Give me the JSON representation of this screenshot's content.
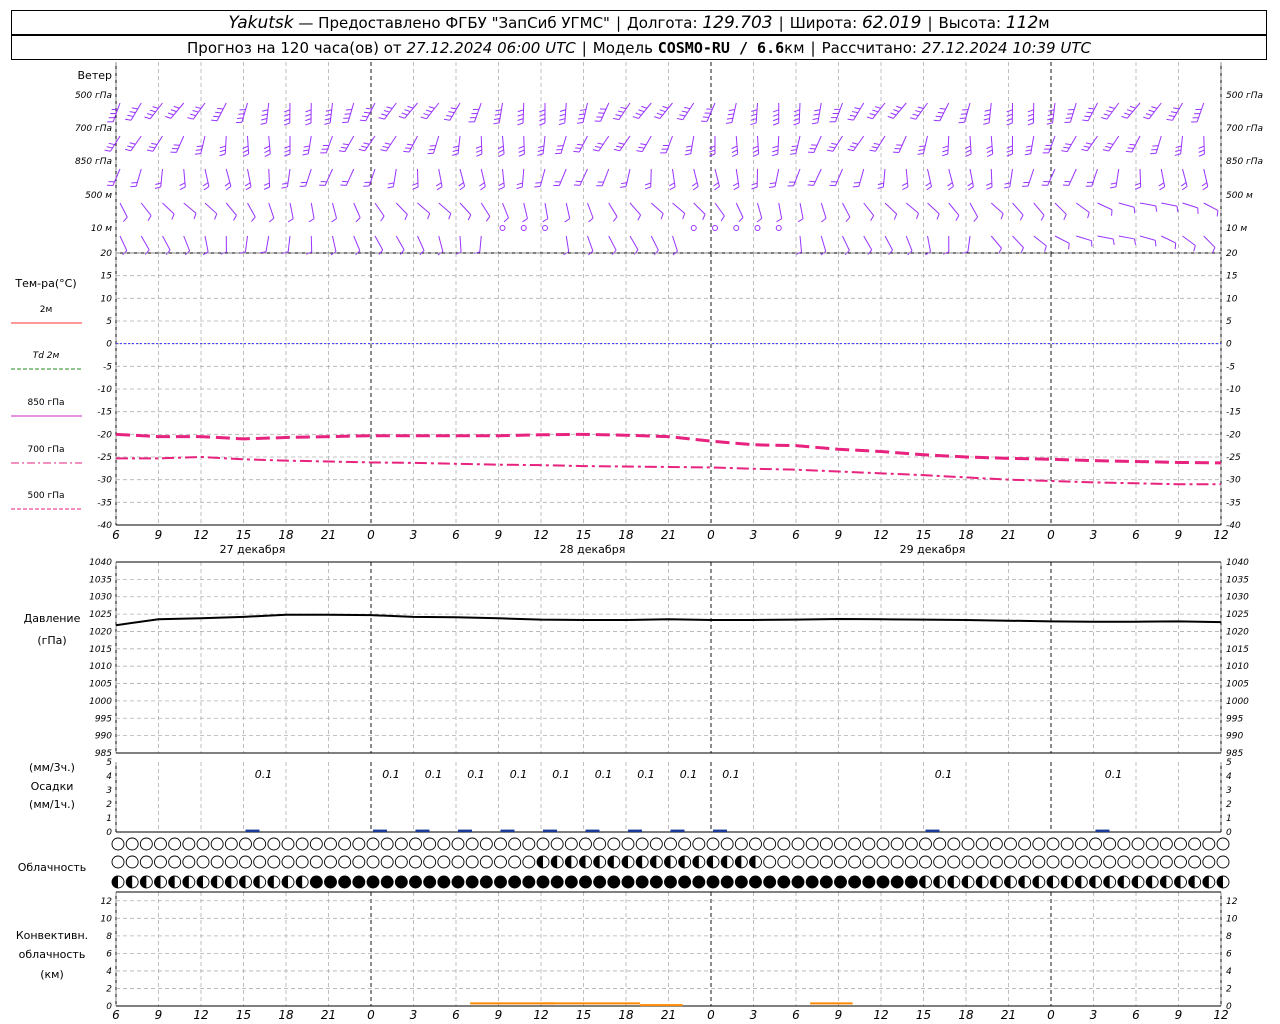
{
  "header": {
    "station": "Yakutsk",
    "provided": "— Предоставлено ФГБУ \"ЗапСиб УГМС\"",
    "lon_label": "Долгота:",
    "lon": "129.703",
    "lat_label": "Широта:",
    "lat": "62.019",
    "alt_label": "Высота:",
    "alt": "112",
    "alt_unit": "м",
    "forecast_prefix": "Прогноз на 120 часа(ов) от",
    "forecast_start": "27.12.2024 06:00 UTC",
    "model_label": "Модель",
    "model": "COSMO-RU / 6.6",
    "model_unit": "км",
    "calc_label": "Рассчитано:",
    "calc_time": "27.12.2024 10:39 UTC"
  },
  "colors": {
    "wind": "#9933ff",
    "t500": "#e8227f",
    "t700": "#e8227f",
    "t850": "#cc22cc",
    "t2m": "#ff3333",
    "td2m": "#228b22",
    "zero_line": "#3333ff",
    "pressure": "#000000",
    "precip": "#1a3a99",
    "conv": "#ff8800",
    "grid": "#b0b0b0"
  },
  "x_ticks": [
    "6",
    "9",
    "12",
    "15",
    "18",
    "21",
    "0",
    "3",
    "6",
    "9",
    "12",
    "15",
    "18",
    "21",
    "0",
    "3",
    "6",
    "9",
    "12",
    "15",
    "18",
    "21",
    "0",
    "3",
    "6",
    "9",
    "12"
  ],
  "dates": [
    "27 декабря",
    "28 декабря",
    "29 декабря"
  ],
  "wind_panel": {
    "title": "Ветер",
    "levels": [
      "500 гПа",
      "700 гПа",
      "850 гПа",
      "500 м",
      "10  м"
    ]
  },
  "temp_panel": {
    "title": "Тем-ра(°C)",
    "legend": [
      {
        "label": "2м",
        "style": "solid",
        "color_key": "t2m"
      },
      {
        "label": "Td  2м",
        "style": "dash",
        "color_key": "td2m"
      },
      {
        "label": "850 гПа",
        "style": "solid",
        "color_key": "t850"
      },
      {
        "label": "700 гПа",
        "style": "dashdot",
        "color_key": "t700"
      },
      {
        "label": "500 гПа",
        "style": "dash",
        "color_key": "t500"
      }
    ],
    "y_ticks": [
      "20",
      "15",
      "10",
      "5",
      "0",
      "-5",
      "-10",
      "-15",
      "-20",
      "-25",
      "-30",
      "-35",
      "-40"
    ]
  },
  "pressure_panel": {
    "title_1": "Давление",
    "title_2": "(гПа)",
    "y_ticks": [
      "1040",
      "1035",
      "1030",
      "1025",
      "1020",
      "1015",
      "1010",
      "1005",
      "1000",
      "995",
      "990",
      "985"
    ]
  },
  "precip_panel": {
    "title_1": "(мм/3ч.)",
    "title_2": "Осадки",
    "title_3": "(мм/1ч.)",
    "y_ticks": [
      "5",
      "4",
      "3",
      "2",
      "1",
      "0"
    ],
    "labels": [
      {
        "h": 9,
        "text": "0.1"
      },
      {
        "h": 18,
        "text": "0.1"
      },
      {
        "h": 21,
        "text": "0.1"
      },
      {
        "h": 24,
        "text": "0.1"
      },
      {
        "h": 27,
        "text": "0.1"
      },
      {
        "h": 30,
        "text": "0.1"
      },
      {
        "h": 33,
        "text": "0.1"
      },
      {
        "h": 36,
        "text": "0.1"
      },
      {
        "h": 39,
        "text": "0.1"
      },
      {
        "h": 42,
        "text": "0.1"
      },
      {
        "h": 57,
        "text": "0.1"
      },
      {
        "h": 69,
        "text": "0.1"
      }
    ]
  },
  "cloud_panel": {
    "title": "Облачность"
  },
  "conv_panel": {
    "title_1": "Конвективн.",
    "title_2": "облачность",
    "title_3": "(км)",
    "y_ticks": [
      "12",
      "10",
      "8",
      "6",
      "4",
      "2",
      "0"
    ]
  },
  "chart_data": [
    {
      "type": "line",
      "title": "Тем-ра(°C)",
      "x_hours_from_start": [
        0,
        3,
        6,
        9,
        12,
        15,
        18,
        21,
        24,
        27,
        30,
        33,
        36,
        39,
        42,
        45,
        48,
        51,
        54,
        57,
        60,
        63,
        66,
        69,
        72,
        75,
        78
      ],
      "ylim": [
        -40,
        20
      ],
      "grid": true,
      "series": [
        {
          "name": "700 гПа",
          "style": "dash",
          "values": [
            -20,
            -20.5,
            -20.5,
            -21,
            -20.7,
            -20.5,
            -20.3,
            -20.3,
            -20.3,
            -20.3,
            -20.1,
            -20,
            -20.2,
            -20.5,
            -21.5,
            -22.3,
            -22.5,
            -23.3,
            -23.8,
            -24.5,
            -25,
            -25.3,
            -25.5,
            -25.8,
            -26,
            -26.2,
            -26.3
          ]
        },
        {
          "name": "850 гПа",
          "style": "dashdot",
          "values": [
            -25.3,
            -25.3,
            -25,
            -25.5,
            -25.8,
            -26,
            -26.2,
            -26.3,
            -26.5,
            -26.7,
            -26.8,
            -27,
            -27.1,
            -27.2,
            -27.3,
            -27.6,
            -27.8,
            -28.2,
            -28.6,
            -29,
            -29.5,
            -30,
            -30.3,
            -30.6,
            -30.8,
            -31,
            -31
          ]
        }
      ]
    },
    {
      "type": "line",
      "title": "Давление",
      "x_hours_from_start": [
        0,
        3,
        6,
        9,
        12,
        15,
        18,
        21,
        24,
        27,
        30,
        33,
        36,
        39,
        42,
        45,
        48,
        51,
        54,
        57,
        60,
        63,
        66,
        69,
        72,
        75,
        78
      ],
      "ylim": [
        985,
        1040
      ],
      "grid": true,
      "series": [
        {
          "name": "Давление",
          "values": [
            1021.8,
            1023.5,
            1023.8,
            1024.2,
            1024.8,
            1024.8,
            1024.7,
            1024.2,
            1024.1,
            1023.8,
            1023.4,
            1023.3,
            1023.3,
            1023.5,
            1023.3,
            1023.3,
            1023.4,
            1023.6,
            1023.5,
            1023.4,
            1023.3,
            1023.1,
            1022.9,
            1022.8,
            1022.8,
            1022.9,
            1022.7
          ]
        }
      ]
    },
    {
      "type": "bar",
      "title": "Осадки",
      "x_hours_from_start": [
        9,
        18,
        21,
        24,
        27,
        30,
        33,
        36,
        39,
        42,
        57,
        69
      ],
      "ylim": [
        0,
        5
      ],
      "values": [
        0.1,
        0.1,
        0.1,
        0.1,
        0.1,
        0.1,
        0.1,
        0.1,
        0.1,
        0.1,
        0.1,
        0.1
      ]
    },
    {
      "type": "bar",
      "title": "Конвективн. облачность (км)",
      "ylim": [
        0,
        13
      ],
      "segments": [
        {
          "from_h": 25,
          "to_h": 31,
          "value": 0.3
        },
        {
          "from_h": 30,
          "to_h": 37,
          "value": 0.3
        },
        {
          "from_h": 37,
          "to_h": 40,
          "value": 0.1
        },
        {
          "from_h": 49,
          "to_h": 52,
          "value": 0.3
        }
      ]
    }
  ]
}
